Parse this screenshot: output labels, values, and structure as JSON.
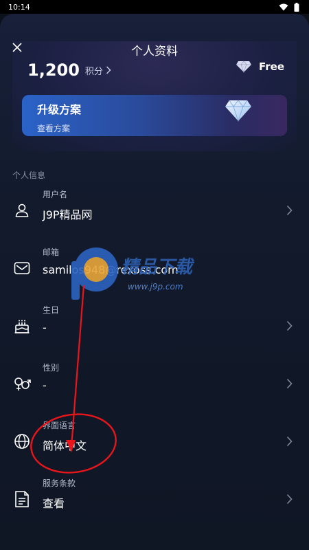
{
  "status": {
    "time": "10:14"
  },
  "header": {
    "title": "个人资料"
  },
  "points": {
    "value": "1,200",
    "label": "积分"
  },
  "plan": {
    "badge": "Free"
  },
  "upgrade": {
    "title": "升级方案",
    "subtitle": "查看方案"
  },
  "section": {
    "title": "个人信息"
  },
  "items": [
    {
      "label": "用户名",
      "value": "J9P精品网"
    },
    {
      "label": "邮箱",
      "value": "samilos948@rexoss.com"
    },
    {
      "label": "生日",
      "value": "-"
    },
    {
      "label": "性别",
      "value": "-"
    },
    {
      "label": "界面语言",
      "value": "简体中文"
    },
    {
      "label": "服务条款",
      "value": "查看"
    }
  ],
  "watermark": {
    "url": "www.j9p.com",
    "brand": "精品下载"
  },
  "colors": {
    "accent": "#2b63c8",
    "annotation": "#e8161b"
  }
}
